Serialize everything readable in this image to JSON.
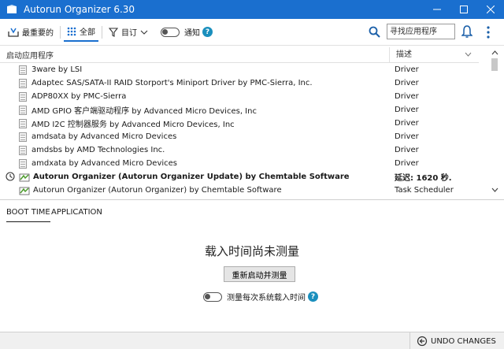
{
  "window": {
    "title": "Autorun Organizer 6.30"
  },
  "toolbar": {
    "most_important": "最重要的",
    "all": "全部",
    "subscription": "目订",
    "notify": "通知",
    "search_placeholder": "寻找应用程序"
  },
  "list": {
    "col_name": "启动应用程序",
    "col_desc": "描述",
    "rows": [
      {
        "name": "3ware by LSI",
        "desc": "Driver"
      },
      {
        "name": "Adaptec SAS/SATA-II RAID Storport's Miniport Driver by PMC-Sierra, Inc.",
        "desc": "Driver"
      },
      {
        "name": "ADP80XX by PMC-Sierra",
        "desc": "Driver"
      },
      {
        "name": "AMD GPIO 客户端驱动程序 by Advanced Micro Devices, Inc",
        "desc": "Driver"
      },
      {
        "name": "AMD I2C 控制器服务 by Advanced Micro Devices, Inc",
        "desc": "Driver"
      },
      {
        "name": "amdsata by Advanced Micro Devices",
        "desc": "Driver"
      },
      {
        "name": "amdsbs by AMD Technologies Inc.",
        "desc": "Driver"
      },
      {
        "name": "amdxata by Advanced Micro Devices",
        "desc": "Driver"
      },
      {
        "name": "Autorun Organizer (Autorun Organizer Update) by Chemtable Software",
        "desc": "延迟: 1620 秒."
      },
      {
        "name": "Autorun Organizer (Autorun Organizer) by Chemtable Software",
        "desc": "Task Scheduler"
      }
    ]
  },
  "tabs": {
    "boot_time": "BOOT TIME",
    "application": "APPLICATION"
  },
  "panel": {
    "message": "载入时间尚未测量",
    "restart_button": "重新启动并测量",
    "measure_label": "测量每次系统载入时间"
  },
  "status": {
    "undo": "UNDO CHANGES"
  },
  "colors": {
    "titlebar": "#1a6fcf",
    "accent": "#1a8fbd"
  }
}
